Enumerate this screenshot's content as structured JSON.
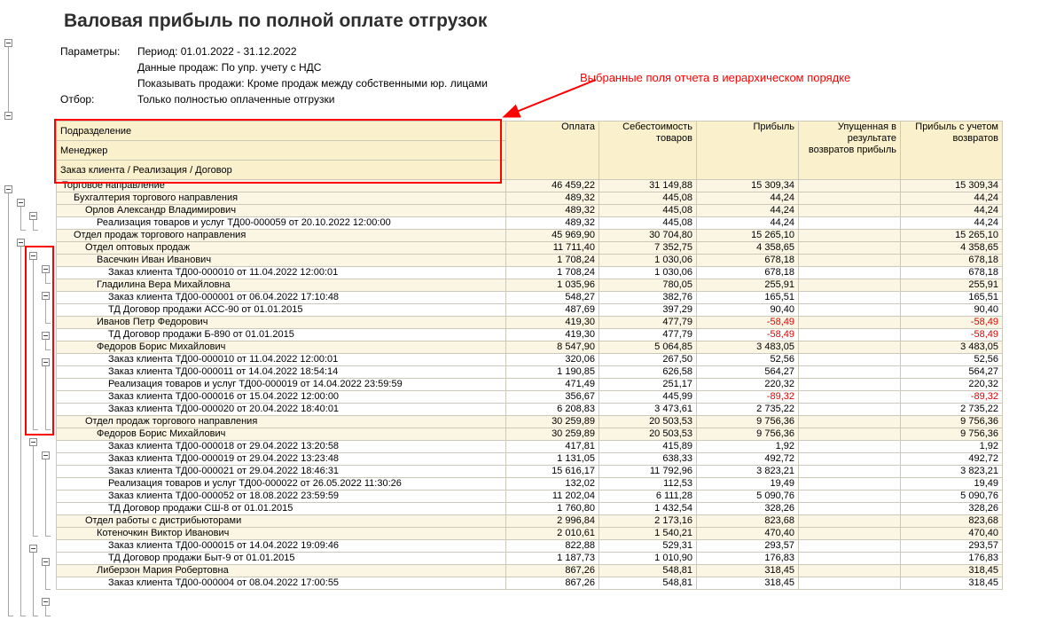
{
  "title": "Валовая прибыль по полной оплате отгрузок",
  "parameters": {
    "lines": [
      {
        "label": "Параметры:",
        "value": "Период: 01.01.2022 - 31.12.2022"
      },
      {
        "label": "",
        "value": "Данные продаж: По упр. учету с НДС"
      },
      {
        "label": "",
        "value": "Показывать продажи: Кроме продаж между собственными юр. лицами"
      },
      {
        "label": "Отбор:",
        "value": "Только полностью оплаченные отгрузки"
      }
    ]
  },
  "annotation": {
    "text": "Выбранные поля отчета в иерархическом порядке",
    "color": "#ff0000"
  },
  "colors": {
    "accent_red": "#ff0000",
    "negative_value": "#e00000",
    "header_background": "#faf1cc",
    "group_row_background": "#faf6e3",
    "grid_line": "#cdc9ba"
  },
  "table": {
    "row_headers": [
      "Подразделение",
      "Менеджер",
      "Заказ клиента / Реализация / Договор"
    ],
    "columns": [
      "Оплата",
      "Себестоимость товаров",
      "Прибыль",
      "Упущенная в результате возвратов прибыль",
      "Прибыль с учетом возвратов"
    ],
    "rows": [
      {
        "label": "Торговое направление",
        "level": 0,
        "group": true,
        "values": [
          "46 459,22",
          "31 149,88",
          "15 309,34",
          "",
          "15 309,34"
        ]
      },
      {
        "label": "Бухгалтерия торгового направления",
        "level": 1,
        "group": true,
        "values": [
          "489,32",
          "445,08",
          "44,24",
          "",
          "44,24"
        ]
      },
      {
        "label": "Орлов Александр Владимирович",
        "level": 2,
        "group": true,
        "values": [
          "489,32",
          "445,08",
          "44,24",
          "",
          "44,24"
        ]
      },
      {
        "label": "Реализация товаров и услуг ТД00-000059 от 20.10.2022 12:00:00",
        "level": 3,
        "group": false,
        "values": [
          "489,32",
          "445,08",
          "44,24",
          "",
          "44,24"
        ]
      },
      {
        "label": "Отдел продаж торгового направления",
        "level": 1,
        "group": true,
        "values": [
          "45 969,90",
          "30 704,80",
          "15 265,10",
          "",
          "15 265,10"
        ]
      },
      {
        "label": "Отдел оптовых продаж",
        "level": 2,
        "group": true,
        "values": [
          "11 711,40",
          "7 352,75",
          "4 358,65",
          "",
          "4 358,65"
        ]
      },
      {
        "label": "Васечкин Иван Иванович",
        "level": 3,
        "group": true,
        "values": [
          "1 708,24",
          "1 030,06",
          "678,18",
          "",
          "678,18"
        ]
      },
      {
        "label": "Заказ клиента ТД00-000010 от 11.04.2022 12:00:01",
        "level": 4,
        "group": false,
        "values": [
          "1 708,24",
          "1 030,06",
          "678,18",
          "",
          "678,18"
        ]
      },
      {
        "label": "Гладилина Вера Михайловна",
        "level": 3,
        "group": true,
        "values": [
          "1 035,96",
          "780,05",
          "255,91",
          "",
          "255,91"
        ]
      },
      {
        "label": "Заказ клиента ТД00-000001 от 06.04.2022 17:10:48",
        "level": 4,
        "group": false,
        "values": [
          "548,27",
          "382,76",
          "165,51",
          "",
          "165,51"
        ]
      },
      {
        "label": "ТД Договор продажи АСС-90 от 01.01.2015",
        "level": 4,
        "group": false,
        "values": [
          "487,69",
          "397,29",
          "90,40",
          "",
          "90,40"
        ]
      },
      {
        "label": "Иванов Петр Федорович",
        "level": 3,
        "group": true,
        "values": [
          "419,30",
          "477,79",
          "-58,49",
          "",
          "-58,49"
        ]
      },
      {
        "label": "ТД Договор продажи Б-890 от 01.01.2015",
        "level": 4,
        "group": false,
        "values": [
          "419,30",
          "477,79",
          "-58,49",
          "",
          "-58,49"
        ]
      },
      {
        "label": "Федоров Борис Михайлович",
        "level": 3,
        "group": true,
        "values": [
          "8 547,90",
          "5 064,85",
          "3 483,05",
          "",
          "3 483,05"
        ]
      },
      {
        "label": "Заказ клиента ТД00-000010 от 11.04.2022 12:00:01",
        "level": 4,
        "group": false,
        "values": [
          "320,06",
          "267,50",
          "52,56",
          "",
          "52,56"
        ]
      },
      {
        "label": "Заказ клиента ТД00-000011 от 14.04.2022 18:54:14",
        "level": 4,
        "group": false,
        "values": [
          "1 190,85",
          "626,58",
          "564,27",
          "",
          "564,27"
        ]
      },
      {
        "label": "Реализация товаров и услуг ТД00-000019 от 14.04.2022 23:59:59",
        "level": 4,
        "group": false,
        "values": [
          "471,49",
          "251,17",
          "220,32",
          "",
          "220,32"
        ]
      },
      {
        "label": "Заказ клиента ТД00-000016 от 15.04.2022 12:00:00",
        "level": 4,
        "group": false,
        "values": [
          "356,67",
          "445,99",
          "-89,32",
          "",
          "-89,32"
        ]
      },
      {
        "label": "Заказ клиента ТД00-000020 от 20.04.2022 18:40:01",
        "level": 4,
        "group": false,
        "values": [
          "6 208,83",
          "3 473,61",
          "2 735,22",
          "",
          "2 735,22"
        ]
      },
      {
        "label": "Отдел продаж торгового направления",
        "level": 2,
        "group": true,
        "values": [
          "30 259,89",
          "20 503,53",
          "9 756,36",
          "",
          "9 756,36"
        ]
      },
      {
        "label": "Федоров Борис Михайлович",
        "level": 3,
        "group": true,
        "values": [
          "30 259,89",
          "20 503,53",
          "9 756,36",
          "",
          "9 756,36"
        ]
      },
      {
        "label": "Заказ клиента ТД00-000018 от 29.04.2022 13:20:58",
        "level": 4,
        "group": false,
        "values": [
          "417,81",
          "415,89",
          "1,92",
          "",
          "1,92"
        ]
      },
      {
        "label": "Заказ клиента ТД00-000019 от 29.04.2022 13:23:48",
        "level": 4,
        "group": false,
        "values": [
          "1 131,05",
          "638,33",
          "492,72",
          "",
          "492,72"
        ]
      },
      {
        "label": "Заказ клиента ТД00-000021 от 29.04.2022 18:46:31",
        "level": 4,
        "group": false,
        "values": [
          "15 616,17",
          "11 792,96",
          "3 823,21",
          "",
          "3 823,21"
        ]
      },
      {
        "label": "Реализация товаров и услуг ТД00-000022 от 26.05.2022 11:30:26",
        "level": 4,
        "group": false,
        "values": [
          "132,02",
          "112,53",
          "19,49",
          "",
          "19,49"
        ]
      },
      {
        "label": "Заказ клиента ТД00-000052 от 18.08.2022 23:59:59",
        "level": 4,
        "group": false,
        "values": [
          "11 202,04",
          "6 111,28",
          "5 090,76",
          "",
          "5 090,76"
        ]
      },
      {
        "label": "ТД Договор продажи СШ-8 от 01.01.2015",
        "level": 4,
        "group": false,
        "values": [
          "1 760,80",
          "1 432,54",
          "328,26",
          "",
          "328,26"
        ]
      },
      {
        "label": "Отдел работы с дистрибьюторами",
        "level": 2,
        "group": true,
        "values": [
          "2 996,84",
          "2 173,16",
          "823,68",
          "",
          "823,68"
        ]
      },
      {
        "label": "Котеночкин Виктор Иванович",
        "level": 3,
        "group": true,
        "values": [
          "2 010,61",
          "1 540,21",
          "470,40",
          "",
          "470,40"
        ]
      },
      {
        "label": "Заказ клиента ТД00-000015 от 14.04.2022 19:09:46",
        "level": 4,
        "group": false,
        "values": [
          "822,88",
          "529,31",
          "293,57",
          "",
          "293,57"
        ]
      },
      {
        "label": "ТД Договор продажи Быт-9 от 01.01.2015",
        "level": 4,
        "group": false,
        "values": [
          "1 187,73",
          "1 010,90",
          "176,83",
          "",
          "176,83"
        ]
      },
      {
        "label": "Либерзон Мария Робертовна",
        "level": 3,
        "group": true,
        "values": [
          "867,26",
          "548,81",
          "318,45",
          "",
          "318,45"
        ]
      },
      {
        "label": "Заказ клиента ТД00-000004 от 08.04.2022 17:00:55",
        "level": 4,
        "group": false,
        "values": [
          "867,26",
          "548,81",
          "318,45",
          "",
          "318,45"
        ]
      }
    ]
  }
}
